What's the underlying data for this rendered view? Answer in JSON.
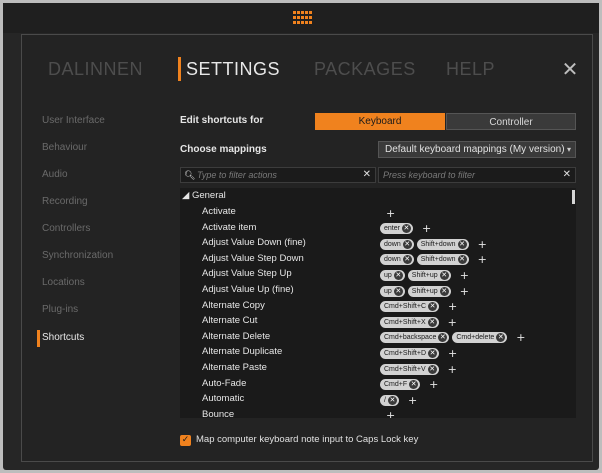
{
  "nav": {
    "items": [
      "DALINNEN",
      "SETTINGS",
      "PACKAGES",
      "HELP"
    ],
    "active": "SETTINGS",
    "close_icon": "close-icon"
  },
  "sidebar": {
    "items": [
      "User Interface",
      "Behaviour",
      "Audio",
      "Recording",
      "Controllers",
      "Synchronization",
      "Locations",
      "Plug-ins",
      "Shortcuts"
    ],
    "active": "Shortcuts"
  },
  "shortcuts": {
    "edit_label": "Edit shortcuts for",
    "keyboard_label": "Keyboard",
    "controller_label": "Controller",
    "choose_label": "Choose mappings",
    "mapping_value": "Default keyboard mappings (My version)",
    "filter_actions_placeholder": "Type to filter actions",
    "filter_keys_placeholder": "Press keyboard to filter",
    "group": "General",
    "items": [
      {
        "name": "Activate",
        "keys": []
      },
      {
        "name": "Activate item",
        "keys": [
          "enter"
        ]
      },
      {
        "name": "Adjust Value Down (fine)",
        "keys": [
          "down",
          "Shift+down"
        ]
      },
      {
        "name": "Adjust Value Step Down",
        "keys": [
          "down",
          "Shift+down"
        ]
      },
      {
        "name": "Adjust Value Step Up",
        "keys": [
          "up",
          "Shift+up"
        ]
      },
      {
        "name": "Adjust Value Up (fine)",
        "keys": [
          "up",
          "Shift+up"
        ]
      },
      {
        "name": "Alternate Copy",
        "keys": [
          "Cmd+Shift+C"
        ]
      },
      {
        "name": "Alternate Cut",
        "keys": [
          "Cmd+Shift+X"
        ]
      },
      {
        "name": "Alternate Delete",
        "keys": [
          "Cmd+backspace",
          "Cmd+delete"
        ]
      },
      {
        "name": "Alternate Duplicate",
        "keys": [
          "Cmd+Shift+D"
        ]
      },
      {
        "name": "Alternate Paste",
        "keys": [
          "Cmd+Shift+V"
        ]
      },
      {
        "name": "Auto-Fade",
        "keys": [
          "Cmd+F"
        ]
      },
      {
        "name": "Automatic",
        "keys": [
          "/"
        ]
      },
      {
        "name": "Bounce",
        "keys": []
      }
    ],
    "caps_lock_label": "Map computer keyboard note input to Caps Lock key",
    "caps_lock_checked": true
  },
  "colors": {
    "accent": "#f0821e",
    "background": "#232323"
  }
}
